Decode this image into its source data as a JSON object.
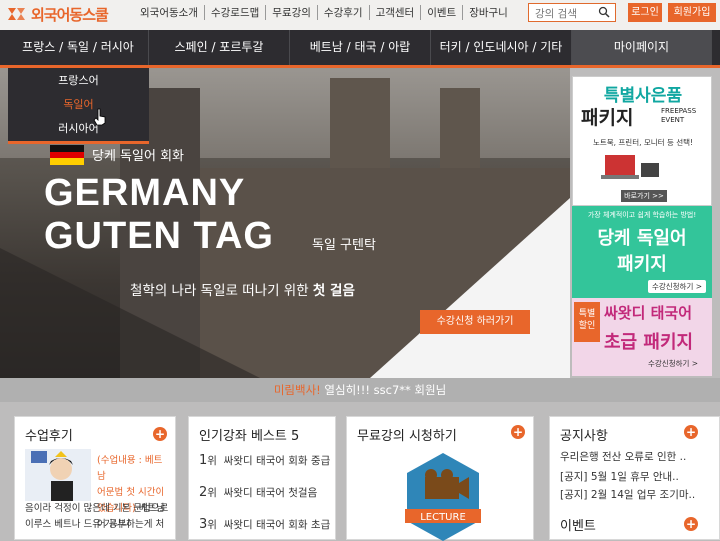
{
  "brand": {
    "logo_text": "외국어동스쿨"
  },
  "topnav": [
    "외국어동소개",
    "수강로드맵",
    "무료강의",
    "수강후기",
    "고객센터",
    "이벤트",
    "장바구니"
  ],
  "search": {
    "placeholder": "강의 검색"
  },
  "auth": {
    "login": "로그인",
    "join": "회원가입"
  },
  "mainnav": [
    "프랑스 / 독일 / 러시아",
    "스페인 / 포르투갈",
    "베트남 / 태국 / 아랍",
    "터키 / 인도네시아 / 기타",
    "마이페이지"
  ],
  "dropdown": [
    "프랑스어",
    "독일어",
    "러시아어"
  ],
  "hero": {
    "tagline": "당케 독일어 회화",
    "title1": "GERMANY",
    "title2": "GUTEN TAG",
    "subtitle": "독일 구텐탁",
    "desc_pre": "철학의 나라 독일로 떠나기 위한 ",
    "desc_bold": "첫 걸음",
    "button": "수강신청 하러가기"
  },
  "banner1": {
    "title": "특별사은품",
    "package": "패키지",
    "freepass1": "FREEPASS",
    "freepass2": "EVENT",
    "items": "노트북, 프린터, 모니터 등 선택!",
    "more": "바로가기 >>"
  },
  "banner2": {
    "small": "가장 체계적이고 쉽게 학습하는 방법!",
    "line1": "당케 독일어",
    "line2": "패키지",
    "button": "수강신청하기 >"
  },
  "banner3": {
    "tag1": "특별",
    "tag2": "할인",
    "line1": "싸왓디 태국어",
    "line2": "초급 패키지",
    "button": "수강신청하기 >"
  },
  "strip": {
    "prefix": "미림백사!",
    "text": " 열심히!!! ssc7** 회원님"
  },
  "cards": {
    "review": {
      "title": "수업후기",
      "t1": "(수업내용 : 베트남",
      "t2": "어문법 첫 시간이",
      "t3": "었습니다)",
      "t4": " 베트남",
      "t5": "어 공부하는게 처",
      "line2": "음이라 걱정이 많은데 기본 문법으로",
      "line3": "이루스 베트나 드유 기니니"
    },
    "best": {
      "title": "인기강좌 베스트 5",
      "items": [
        {
          "n": "1",
          "u": "위",
          "t": "싸왓디 태국어 회화 중급"
        },
        {
          "n": "2",
          "u": "위",
          "t": "싸왓디 태국어 첫걸음"
        },
        {
          "n": "3",
          "u": "위",
          "t": "싸왓디 태국어 회화 초급"
        }
      ]
    },
    "free": {
      "title": "무료강의 시청하기",
      "badge": "LECTURE"
    },
    "notice": {
      "title": "공지사항",
      "items": [
        "우리은행 전산 오류로 인한 ..",
        "[공지] 5월 1일 휴무 안내..",
        "[공지] 2월 14일 업무 조기마.."
      ],
      "event_title": "이벤트"
    }
  },
  "colors": {
    "accent": "#e8662b",
    "nav": "#2d2c30",
    "teal": "#33c59a",
    "pink": "#c2297a"
  }
}
